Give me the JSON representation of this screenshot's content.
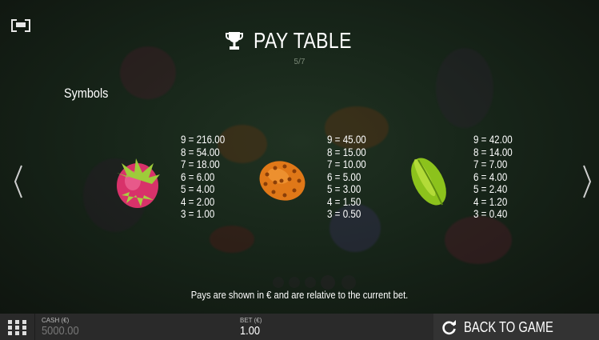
{
  "header": {
    "title": "PAY TABLE",
    "page_indicator": "5/7"
  },
  "section": {
    "title": "Symbols"
  },
  "symbols": [
    {
      "name": "dragon-fruit",
      "payouts": [
        "9 = 216.00",
        "8 = 54.00",
        "7 = 18.00",
        "6 = 6.00",
        "5 = 4.00",
        "4 = 2.00",
        "3 = 1.00"
      ]
    },
    {
      "name": "kiwano",
      "payouts": [
        "9 = 45.00",
        "8 = 15.00",
        "7 = 10.00",
        "6 = 5.00",
        "5 = 3.00",
        "4 = 1.50",
        "3 = 0.50"
      ]
    },
    {
      "name": "starfruit",
      "payouts": [
        "9 = 42.00",
        "8 = 14.00",
        "7 = 7.00",
        "6 = 4.00",
        "5 = 2.40",
        "4 = 1.20",
        "3 = 0.40"
      ]
    }
  ],
  "note": "Pays are shown in € and are relative to the current bet.",
  "bottom_bar": {
    "cash_label": "CASH (€)",
    "cash_value": "5000.00",
    "bet_label": "BET (€)",
    "bet_value": "1.00",
    "back_label": "BACK TO GAME"
  },
  "icons": {
    "fullscreen": "fullscreen-icon",
    "trophy": "trophy-icon",
    "prev": "chevron-left-icon",
    "next": "chevron-right-icon",
    "menu": "grid-menu-icon",
    "back": "refresh-icon"
  },
  "colors": {
    "background": "#1a2a1c",
    "bottom_bar": "#2a2a2a",
    "text": "#ffffff"
  }
}
